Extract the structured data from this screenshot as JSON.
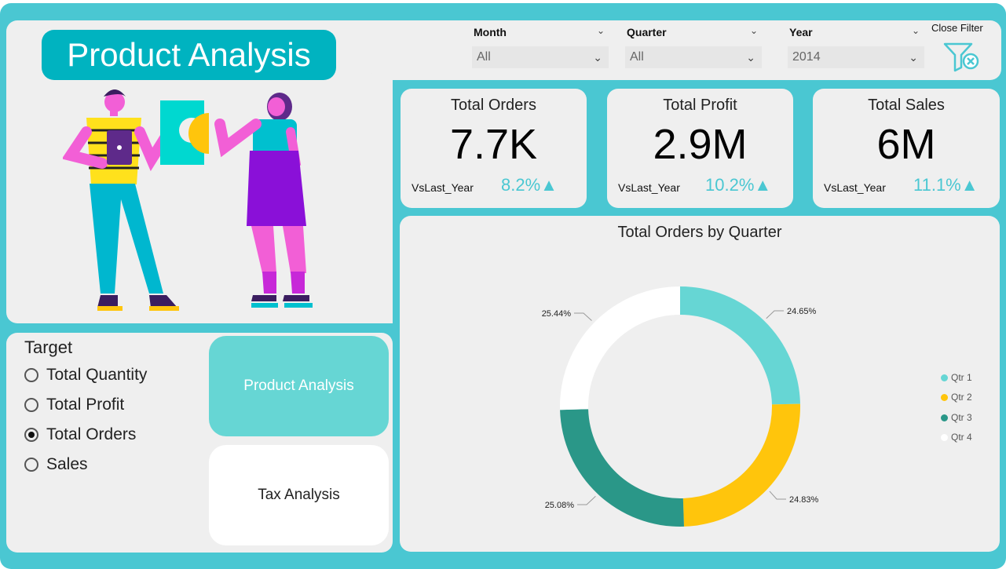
{
  "header": {
    "title": "Product Analysis"
  },
  "filters": {
    "month": {
      "label": "Month",
      "value": "All"
    },
    "quarter": {
      "label": "Quarter",
      "value": "All"
    },
    "year": {
      "label": "Year",
      "value": "2014"
    },
    "close_label": "Close Filter"
  },
  "kpis": [
    {
      "title": "Total Orders",
      "value": "7.7K",
      "sub": "VsLast_Year",
      "pct": "8.2%"
    },
    {
      "title": "Total Profit",
      "value": "2.9M",
      "sub": "VsLast_Year",
      "pct": "10.2%"
    },
    {
      "title": "Total Sales",
      "value": "6M",
      "sub": "VsLast_Year",
      "pct": "11.1%"
    }
  ],
  "target": {
    "title": "Target",
    "options": [
      "Total Quantity",
      "Total Profit",
      "Total Orders",
      "Sales"
    ],
    "selected": "Total Orders"
  },
  "nav": {
    "product": "Product Analysis",
    "tax": "Tax Analysis"
  },
  "colors": {
    "accent": "#4ac7d2",
    "qtr1": "#66d6d4",
    "qtr2": "#ffc50c",
    "qtr3": "#2a9788",
    "qtr4": "#ffffff"
  },
  "chart_data": {
    "type": "pie",
    "title": "Total Orders by Quarter",
    "categories": [
      "Qtr 1",
      "Qtr 2",
      "Qtr 3",
      "Qtr 4"
    ],
    "values": [
      24.65,
      24.83,
      25.08,
      25.44
    ],
    "labels": [
      "24.65%",
      "24.83%",
      "25.08%",
      "25.44%"
    ],
    "legend": "right"
  }
}
